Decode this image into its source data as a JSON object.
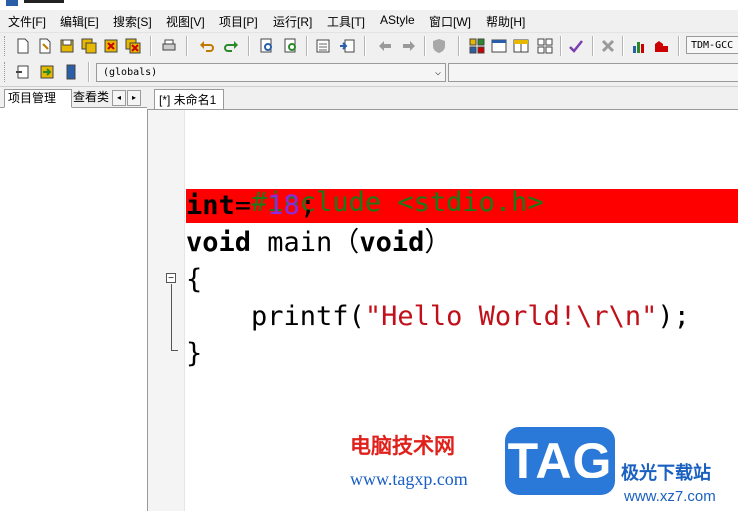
{
  "menu": {
    "items": [
      "文件[F]",
      "编辑[E]",
      "搜索[S]",
      "视图[V]",
      "项目[P]",
      "运行[R]",
      "工具[T]",
      "AStyle",
      "窗口[W]",
      "帮助[H]"
    ]
  },
  "toolbar": {
    "compiler": "TDM-GCC",
    "scope_value": "(globals)"
  },
  "left_panel": {
    "tabs": [
      "项目管理",
      "查看类"
    ],
    "spin_left": "◂",
    "spin_right": "▸"
  },
  "editor": {
    "tab_label": "[*] 未命名1",
    "highlight_color": "#ff0000",
    "fold_symbol": "−",
    "lines": {
      "l1": "#include <stdio.h>",
      "l2_kw": "int",
      "l2_op": "= ",
      "l2_num": "18",
      "l2_end": ";",
      "l3_kw1": "void",
      "l3_mid": " main（",
      "l3_kw2": "void",
      "l3_end": "）",
      "l4": "{",
      "l5_pre": "    printf(",
      "l5_str": "\"Hello World!\\r\\n\"",
      "l5_end": ");",
      "l6": "}"
    }
  },
  "watermark": {
    "site_name": "电脑技术网",
    "site_url": "www.tagxp.com",
    "tag_logo": "TAG",
    "site_name2": "极光下载站",
    "site_url2": "www.xz7.com"
  },
  "colors": {
    "keyword": "#000000",
    "preprocessor": "#1a7a1a",
    "number": "#8a2be2",
    "string": "#c0101a"
  }
}
